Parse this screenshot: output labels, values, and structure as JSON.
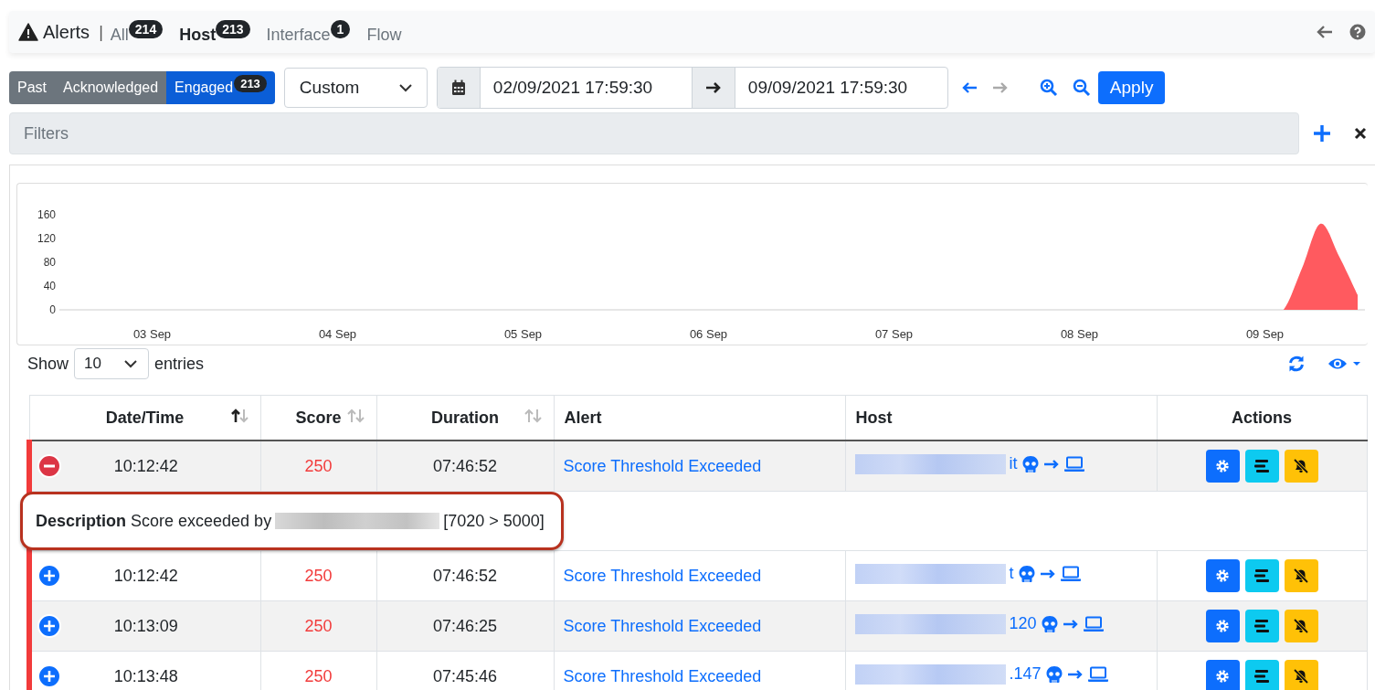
{
  "navbar": {
    "title": "Alerts",
    "separator": "|",
    "tabs": [
      {
        "label": "All",
        "count": "214",
        "selected": false
      },
      {
        "label": "Host",
        "count": "213",
        "selected": true
      },
      {
        "label": "Interface",
        "count": "1",
        "selected": false
      },
      {
        "label": "Flow",
        "selected": false
      }
    ]
  },
  "status_filter": [
    {
      "label": "Past",
      "selected": false
    },
    {
      "label": "Acknowledged",
      "selected": false
    },
    {
      "label": "Engaged",
      "count": "213",
      "selected": true
    }
  ],
  "range_select": {
    "value": "Custom"
  },
  "date_range": {
    "from": "02/09/2021 17:59:30",
    "to": "09/09/2021 17:59:30"
  },
  "time_arrows": [
    {
      "disabled": false
    },
    {
      "disabled": true
    }
  ],
  "apply_button": "Apply",
  "filters": {
    "placeholder": "Filters"
  },
  "chart": {
    "chart_data": {
      "type": "area",
      "categories": [
        null,
        null,
        null,
        null,
        null,
        "03 Sep",
        null,
        null,
        null,
        null,
        null,
        null,
        null,
        null,
        null,
        "04 Sep",
        null,
        null,
        null,
        null,
        null,
        null,
        null,
        null,
        null,
        "05 Sep",
        null,
        null,
        null,
        null,
        null,
        null,
        null,
        null,
        null,
        "06 Sep",
        null,
        null,
        null,
        null,
        null,
        null,
        null,
        null,
        null,
        "07 Sep",
        null,
        null,
        null,
        null,
        null,
        null,
        null,
        null,
        null,
        "08 Sep",
        null,
        null,
        null,
        null,
        null,
        null,
        null,
        null,
        null,
        "09 Sep",
        null,
        null,
        null,
        null,
        null
      ],
      "series": [
        {
          "color": "#ff5a5f",
          "values": [
            0,
            0,
            0,
            0,
            0,
            0,
            0,
            0,
            0,
            0,
            0,
            0,
            0,
            0,
            0,
            0,
            0,
            0,
            0,
            0,
            0,
            0,
            0,
            0,
            0,
            0,
            0,
            0,
            0,
            0,
            0,
            0,
            0,
            0,
            0,
            0,
            0,
            0,
            0,
            0,
            0,
            0,
            0,
            0,
            0,
            0,
            0,
            0,
            0,
            0,
            0,
            0,
            0,
            0,
            0,
            0,
            0,
            0,
            0,
            0,
            0,
            0,
            0,
            0,
            0,
            0,
            0,
            70,
            145,
            90,
            25
          ]
        }
      ],
      "ylim": [
        0,
        160
      ],
      "yticks": [
        0,
        40,
        80,
        120,
        160
      ]
    }
  },
  "page_length": {
    "label_before": "Show",
    "value": "10",
    "label_after": "entries"
  },
  "table": {
    "columns": [
      {
        "label": "Date/Time",
        "sortable": true,
        "sorted": true
      },
      {
        "label": "Score",
        "sortable": true,
        "sorted": false
      },
      {
        "label": "Duration",
        "sortable": true,
        "sorted": false
      },
      {
        "label": "Alert",
        "sortable": false
      },
      {
        "label": "Host",
        "sortable": false
      },
      {
        "label": "Actions",
        "sortable": false
      }
    ],
    "rows": [
      {
        "expanded": true,
        "time": "10:12:42",
        "score": "250",
        "duration": "07:46:52",
        "alert": "Score Threshold Exceeded",
        "host_suffix": "it",
        "description": {
          "text": "**Description** Score exceeded by",
          "values": "[7020 > 5000]"
        }
      },
      {
        "expanded": false,
        "time": "10:12:42",
        "score": "250",
        "duration": "07:46:52",
        "alert": "Score Threshold Exceeded",
        "host_suffix": "t"
      },
      {
        "expanded": false,
        "time": "10:13:09",
        "score": "250",
        "duration": "07:46:25",
        "alert": "Score Threshold Exceeded",
        "host_suffix": "120"
      },
      {
        "expanded": false,
        "time": "10:13:48",
        "score": "250",
        "duration": "07:45:46",
        "alert": "Score Threshold Exceeded",
        "host_suffix": ".147"
      }
    ]
  }
}
